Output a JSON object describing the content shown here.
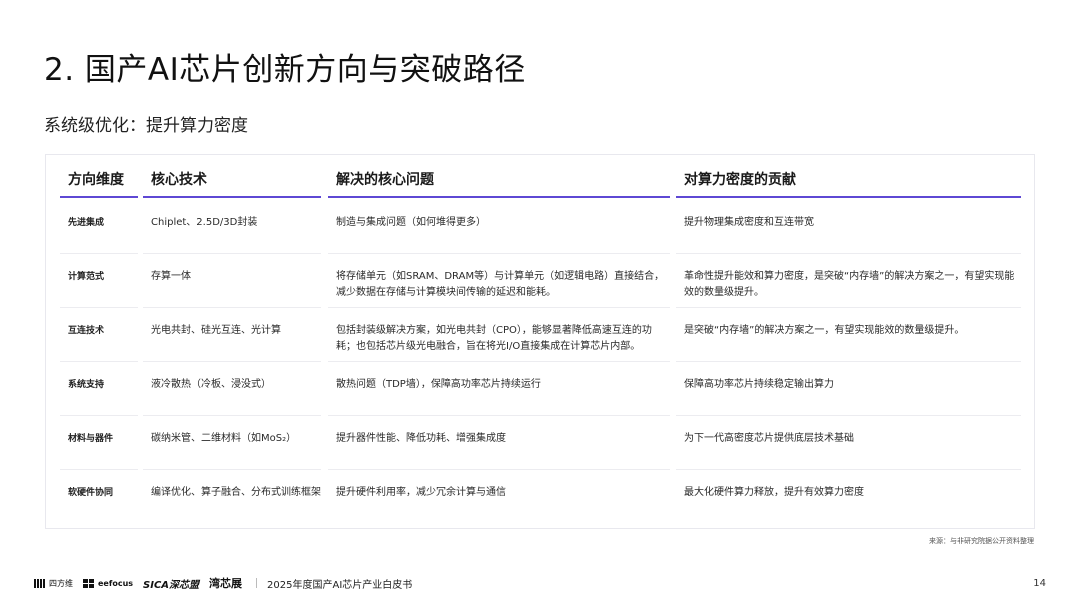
{
  "page": {
    "title": "2. 国产AI芯片创新方向与突破路径",
    "subtitle": "系统级优化：提升算力密度"
  },
  "table": {
    "headers": [
      "方向维度",
      "核心技术",
      "解决的核心问题",
      "对算力密度的贡献"
    ],
    "rows": [
      [
        "先进集成",
        "Chiplet、2.5D/3D封装",
        "制造与集成问题（如何堆得更多）",
        "提升物理集成密度和互连带宽"
      ],
      [
        "计算范式",
        "存算一体",
        "将存储单元（如SRAM、DRAM等）与计算单元（如逻辑电路）直接结合，减少数据在存储与计算模块间传输的延迟和能耗。",
        "革命性提升能效和算力密度，是突破“内存墙”的解决方案之一，有望实现能效的数量级提升。"
      ],
      [
        "互连技术",
        "光电共封、硅光互连、光计算",
        "包括封装级解决方案，如光电共封（CPO），能够显著降低高速互连的功耗；也包括芯片级光电融合，旨在将光I/O直接集成在计算芯片内部。",
        "是突破“内存墙”的解决方案之一，有望实现能效的数量级提升。"
      ],
      [
        "系统支持",
        "液冷散热（冷板、浸没式）",
        "散热问题（TDP墙），保障高功率芯片持续运行",
        "保障高功率芯片持续稳定输出算力"
      ],
      [
        "材料与器件",
        "碳纳米管、二维材料（如MoS₂）",
        "提升器件性能、降低功耗、增强集成度",
        "为下一代高密度芯片提供底层技术基础"
      ],
      [
        "软硬件协同",
        "编译优化、算子融合、分布式训练框架",
        "提升硬件利用率，减少冗余计算与通信",
        "最大化硬件算力释放，提升有效算力密度"
      ]
    ],
    "accent_color": "#5e48d4"
  },
  "source_note": "来源：与非研究院据公开资料整理",
  "footer": {
    "logos": [
      "四方维",
      "eefocus",
      "SICA深芯盟",
      "湾芯展"
    ],
    "report_title": "2025年度国产AI芯片产业白皮书",
    "page_number": "14"
  }
}
